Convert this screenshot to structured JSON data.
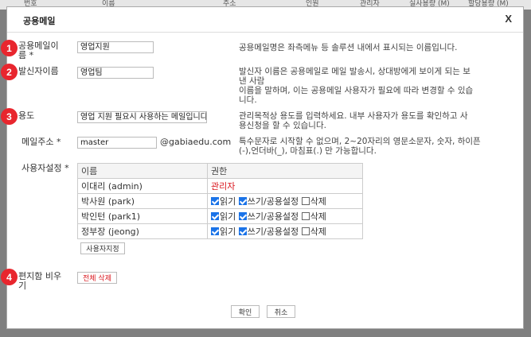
{
  "background": {
    "columns": [
      "번호",
      "이름",
      "주소",
      "인원",
      "관리자",
      "실사용량 (M)",
      "할당용량 (M)"
    ]
  },
  "dialog": {
    "title": "공용메일",
    "close_label": "X"
  },
  "badges": [
    "1",
    "2",
    "3",
    "4"
  ],
  "fields": {
    "name": {
      "label_line1": "공용메일이",
      "label_line2": "름 *",
      "value": "영업지원",
      "desc": [
        "공용메일명은 좌측메뉴 등 솔루션 내에서 표시되는 이름입니다."
      ]
    },
    "sender": {
      "label": "발신자이름",
      "value": "영업팀",
      "desc": [
        "발신자 이름은 공용메일로 메일 발송시, 상대방에게 보이게 되는 보",
        "낸 사람",
        "이름을 말하며, 이는 공용메일 사용자가 필요에 따라 변경할 수 있습",
        "니다."
      ]
    },
    "purpose": {
      "label": "용도",
      "value": "영업 지원 필요시 사용하는 메일입니다",
      "desc": [
        "관리목적상 용도를 입력하세요. 내부 사용자가 용도를 확인하고 사",
        "용신청을 할 수 있습니다."
      ]
    },
    "email": {
      "label": "메일주소 *",
      "value": "master",
      "domain": "@gabiaedu.com",
      "desc": [
        "특수문자로 시작할 수 없으며, 2~20자리의 영문소문자, 숫자, 하이픈",
        "(-),언더바(_), 마침표(.) 만 가능합니다."
      ]
    },
    "users": {
      "label": "사용자설정 *",
      "headers": [
        "이름",
        "권한"
      ],
      "rows": [
        {
          "name": "이대리 (admin)",
          "role": "관리자"
        },
        {
          "name": "박사원 (park)",
          "read": "읽기",
          "write": "쓰기/공용설정",
          "delete": "삭제"
        },
        {
          "name": "박인턴 (park1)",
          "read": "읽기",
          "write": "쓰기/공용설정",
          "delete": "삭제"
        },
        {
          "name": "정부장 (jeong)",
          "read": "읽기",
          "write": "쓰기/공용설정",
          "delete": "삭제"
        }
      ],
      "assign_button": "사용자지정"
    },
    "clear_mailbox": {
      "label_line1": "편지함 비우",
      "label_line2": "기",
      "button": "전체 삭제"
    }
  },
  "footer": {
    "confirm": "확인",
    "cancel": "취소"
  },
  "colors": {
    "badge": "#e8262e",
    "admin_role": "#d9141b",
    "checkbox": "#1a73e8"
  }
}
